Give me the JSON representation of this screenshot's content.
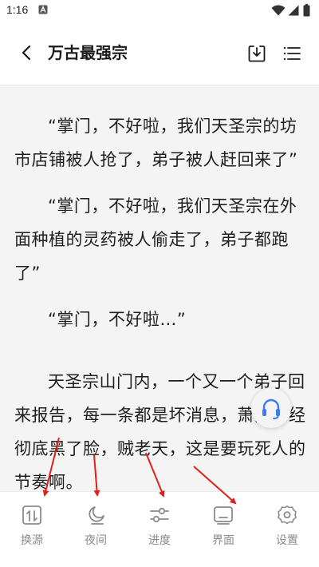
{
  "status_bar": {
    "time": "1:16",
    "icons": [
      "a-notification-icon",
      "wifi-icon",
      "cellular-icon",
      "battery-icon"
    ]
  },
  "app_bar": {
    "title": "万古最强宗",
    "icons": [
      "back-arrow-icon",
      "download-icon",
      "menu-list-icon"
    ]
  },
  "content": {
    "paragraphs": [
      "“掌门，不好啦，我们天圣宗的坊市店铺被人抢了，弟子被人赶回来了”",
      "“掌门，不好啦，我们天圣宗在外面种植的灵药被人偷走了，弟子都跑了”",
      "“掌门，不好啦…”",
      "天圣宗山门内，一个又一个弟子回来报告，每一条都是坏消息，萧笑已经彻底黑了脸，贼老天，这是要玩死人的节奏啊。"
    ]
  },
  "floating": {
    "icon": "headphones-icon"
  },
  "toolbar": {
    "items": [
      {
        "label": "换源",
        "icon": "switch-source-icon"
      },
      {
        "label": "夜间",
        "icon": "night-mode-icon"
      },
      {
        "label": "进度",
        "icon": "progress-slider-icon"
      },
      {
        "label": "界面",
        "icon": "interface-icon"
      },
      {
        "label": "设置",
        "icon": "settings-gear-icon"
      }
    ]
  },
  "colors": {
    "background": "#f4f4f4",
    "bar": "#ffffff",
    "text": "#1e1e1e",
    "toolbar_icon": "#8a8a8a",
    "annotation_arrow": "#e0201b",
    "audio_icon": "#3a7df0"
  }
}
